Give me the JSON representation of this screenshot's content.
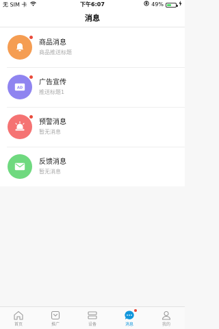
{
  "status_bar": {
    "carrier": "无 SIM 卡",
    "time": "下午6:07",
    "battery": "49%",
    "battery_level": 0.49
  },
  "nav": {
    "title": "消息"
  },
  "messages": [
    {
      "title": "商品消息",
      "subtitle": "商品推送标题",
      "icon": "bell-icon",
      "color": "#f59d52",
      "unread": true
    },
    {
      "title": "广告宣传",
      "subtitle": "推送标题1",
      "icon": "ad-icon",
      "color": "#8f84f0",
      "unread": true
    },
    {
      "title": "预警消息",
      "subtitle": "暂无消息",
      "icon": "alarm-icon",
      "color": "#f57373",
      "unread": true
    },
    {
      "title": "反馈消息",
      "subtitle": "暂无消息",
      "icon": "mail-icon",
      "color": "#6fd97f",
      "unread": false
    }
  ],
  "tabs": [
    {
      "label": "首页",
      "icon": "home-icon",
      "active": false
    },
    {
      "label": "推广",
      "icon": "promo-icon",
      "active": false
    },
    {
      "label": "设备",
      "icon": "device-icon",
      "active": false
    },
    {
      "label": "消息",
      "icon": "message-icon",
      "active": true,
      "badge": true
    },
    {
      "label": "我的",
      "icon": "user-icon",
      "active": false
    }
  ],
  "colors": {
    "accent": "#1296db",
    "badge": "#e94b3c"
  }
}
